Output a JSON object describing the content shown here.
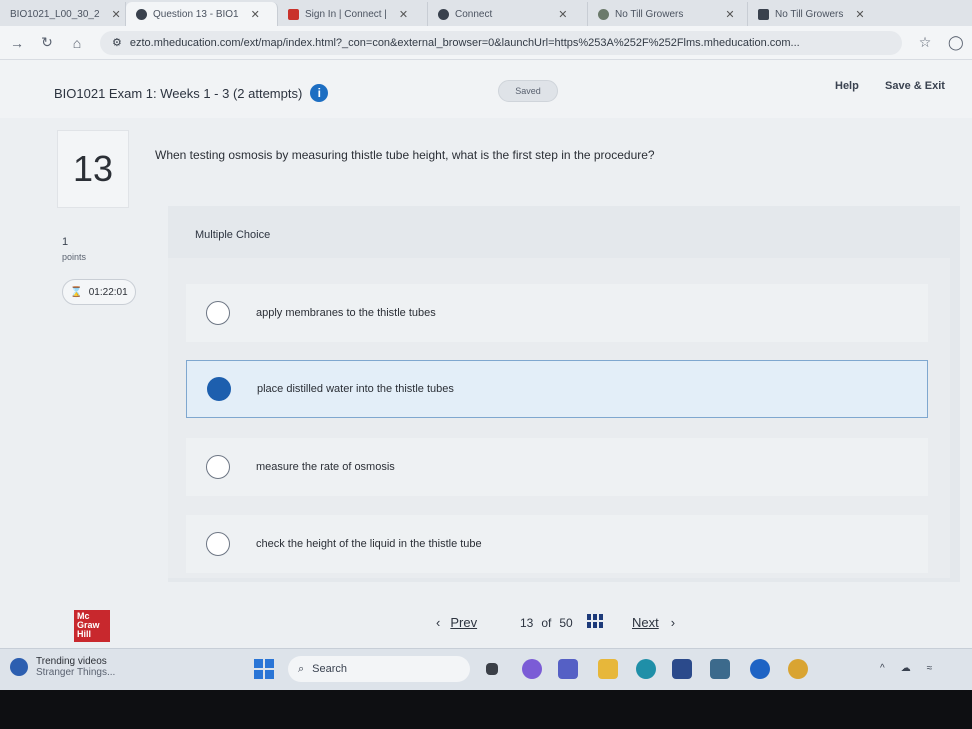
{
  "browser": {
    "tabs": [
      {
        "label": "BIO1021_L00_30_2",
        "icon": "doc-icon"
      },
      {
        "label": "Question 13 - BIO1",
        "icon": "connect-icon"
      },
      {
        "label": "Sign In | Connect |",
        "icon": "mh-icon"
      },
      {
        "label": "Connect",
        "icon": "connect-icon"
      },
      {
        "label": "No Till Growers",
        "icon": "leaf-icon"
      },
      {
        "label": "No Till Growers",
        "icon": "video-icon"
      }
    ],
    "url": "ezto.mheducation.com/ext/map/index.html?_con=con&external_browser=0&launchUrl=https%253A%252F%252Flms.mheducation.com..."
  },
  "header": {
    "exam_title": "BIO1021 Exam 1: Weeks 1 - 3 (2 attempts)",
    "saved_label": "Saved",
    "help_label": "Help",
    "save_exit_label": "Save & Exit"
  },
  "question": {
    "number": "13",
    "text": "When testing osmosis by measuring thistle tube height, what is the first step in the procedure?",
    "points_value": "1",
    "points_label": "points",
    "timer": "01:22:01",
    "type_label": "Multiple Choice",
    "choices": [
      {
        "text": "apply membranes to the thistle tubes",
        "selected": false
      },
      {
        "text": "place distilled water into the thistle tubes",
        "selected": true
      },
      {
        "text": "measure the rate of osmosis",
        "selected": false
      },
      {
        "text": "check the height of the liquid in the thistle tube",
        "selected": false
      }
    ]
  },
  "footer": {
    "logo_text": "Mc Graw Hill",
    "prev_label": "Prev",
    "current_page": "13",
    "of_label": "of",
    "total_pages": "50",
    "next_label": "Next"
  },
  "taskbar": {
    "news_title": "Trending videos",
    "news_subtitle": "Stranger Things...",
    "search_label": "Search"
  },
  "colors": {
    "accent": "#1d5fae",
    "selected_bg": "#e3eef8",
    "logo_red": "#c8282d"
  }
}
